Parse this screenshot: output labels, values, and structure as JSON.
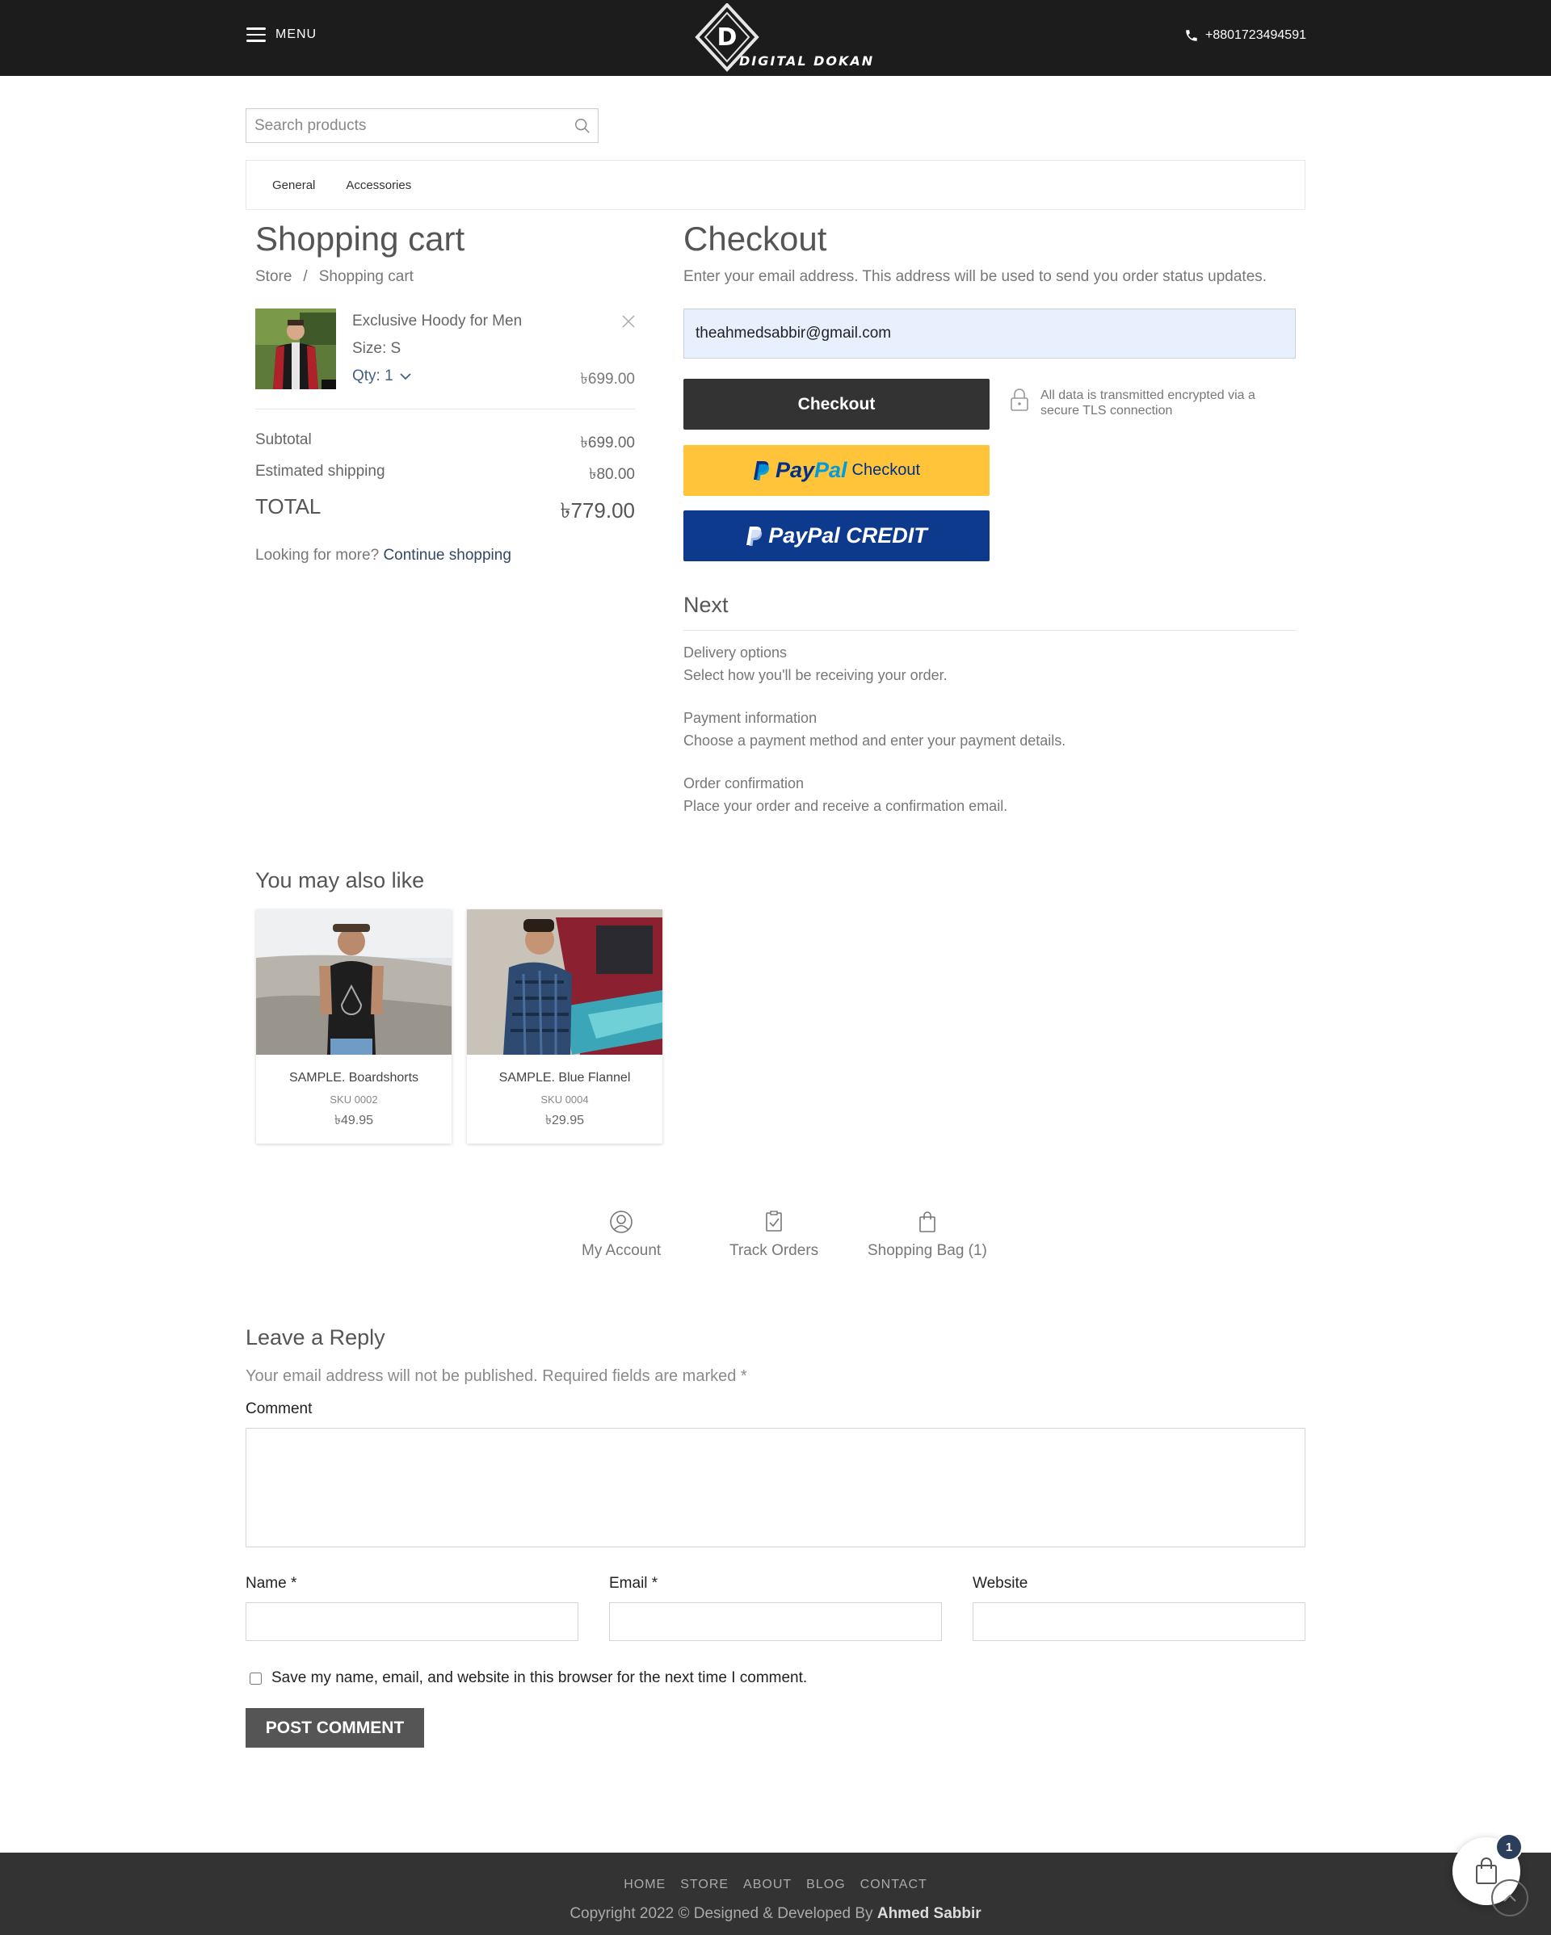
{
  "header": {
    "menu_label": "MENU",
    "logo_letter": "D",
    "logo_text": "DIGITAL DOKAN",
    "phone": "+8801723494591"
  },
  "search": {
    "placeholder": "Search products"
  },
  "categories": [
    "General",
    "Accessories"
  ],
  "cart": {
    "title": "Shopping cart",
    "breadcrumb": [
      "Store",
      "/",
      "Shopping cart"
    ],
    "item": {
      "name": "Exclusive Hoody for Men",
      "size": "Size: S",
      "qty": "Qty: 1",
      "price": "৳699.00"
    },
    "subtotal_label": "Subtotal",
    "subtotal": "৳699.00",
    "shipping_label": "Estimated shipping",
    "shipping": "৳80.00",
    "total_label": "TOTAL",
    "total": "৳779.00",
    "looking_text": "Looking for more?",
    "continue_link": "Continue shopping"
  },
  "checkout": {
    "title": "Checkout",
    "subtitle": "Enter your email address. This address will be used to send you order status updates.",
    "email_value": "theahmedsabbir@gmail.com",
    "checkout_button": "Checkout",
    "paypal_pay": "Pay",
    "paypal_pal": "Pal",
    "paypal_checkout": "Checkout",
    "paypal_credit": "PayPal CREDIT",
    "secure_text": "All data is transmitted encrypted via a secure TLS connection",
    "next_title": "Next",
    "steps": [
      {
        "title": "Delivery options",
        "desc": "Select how you'll be receiving your order."
      },
      {
        "title": "Payment information",
        "desc": "Choose a payment method and enter your payment details."
      },
      {
        "title": "Order confirmation",
        "desc": "Place your order and receive a confirmation email."
      }
    ]
  },
  "recommendations": {
    "title": "You may also like",
    "products": [
      {
        "name": "SAMPLE. Boardshorts",
        "sku": "SKU 0002",
        "price": "৳49.95"
      },
      {
        "name": "SAMPLE. Blue Flannel",
        "sku": "SKU 0004",
        "price": "৳29.95"
      }
    ]
  },
  "footer_nav": [
    {
      "label": "My Account",
      "icon": "user-icon"
    },
    {
      "label": "Track Orders",
      "icon": "checklist-icon"
    },
    {
      "label": "Shopping Bag (1)",
      "icon": "bag-icon"
    }
  ],
  "reply": {
    "title": "Leave a Reply",
    "note": "Your email address will not be published. Required fields are marked *",
    "comment_label": "Comment",
    "name_label": "Name *",
    "email_label": "Email *",
    "website_label": "Website",
    "save_label": "Save my name, email, and website in this browser for the next time I comment.",
    "post_button": "POST COMMENT"
  },
  "footer": {
    "links": [
      "HOME",
      "STORE",
      "ABOUT",
      "BLOG",
      "CONTACT"
    ],
    "copyright_prefix": "Copyright 2022 © Designed & Developed By",
    "author": "Ahmed Sabbir",
    "cart_count": "1"
  },
  "colors": {
    "header_bg": "#1c1c1c",
    "checkout_btn": "#333333",
    "paypal_yellow": "#ffc439",
    "paypal_credit_blue": "#0e3a8e",
    "link_blue": "#334862",
    "footer_bg": "#333333",
    "badge": "#2b3e5b"
  }
}
